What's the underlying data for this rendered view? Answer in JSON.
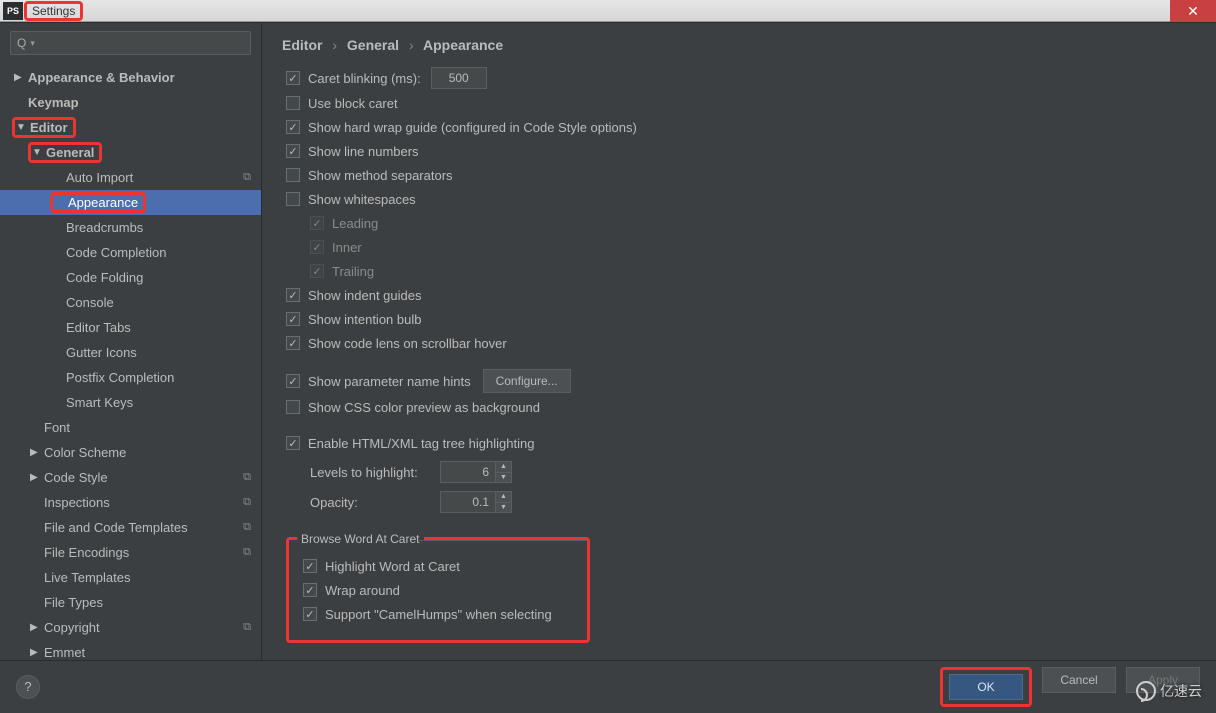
{
  "window": {
    "title": "Settings",
    "app_badge": "PS"
  },
  "search": {
    "placeholder": ""
  },
  "tree": {
    "items": [
      {
        "label": "Appearance & Behavior",
        "arrow": "▶",
        "bold": true,
        "indent": 0
      },
      {
        "label": "Keymap",
        "arrow": "",
        "bold": true,
        "indent": 0
      },
      {
        "label": "Editor",
        "arrow": "▼",
        "bold": true,
        "indent": 0,
        "hl": true
      },
      {
        "label": "General",
        "arrow": "▼",
        "bold": true,
        "indent": 1,
        "hl": true
      },
      {
        "label": "Auto Import",
        "arrow": "",
        "indent": 2,
        "copy": true
      },
      {
        "label": "Appearance",
        "arrow": "",
        "indent": 2,
        "selected": true,
        "hl": true
      },
      {
        "label": "Breadcrumbs",
        "arrow": "",
        "indent": 2
      },
      {
        "label": "Code Completion",
        "arrow": "",
        "indent": 2
      },
      {
        "label": "Code Folding",
        "arrow": "",
        "indent": 2
      },
      {
        "label": "Console",
        "arrow": "",
        "indent": 2
      },
      {
        "label": "Editor Tabs",
        "arrow": "",
        "indent": 2
      },
      {
        "label": "Gutter Icons",
        "arrow": "",
        "indent": 2
      },
      {
        "label": "Postfix Completion",
        "arrow": "",
        "indent": 2
      },
      {
        "label": "Smart Keys",
        "arrow": "",
        "indent": 2
      },
      {
        "label": "Font",
        "arrow": "",
        "indent": 1
      },
      {
        "label": "Color Scheme",
        "arrow": "▶",
        "indent": 1
      },
      {
        "label": "Code Style",
        "arrow": "▶",
        "indent": 1,
        "copy": true
      },
      {
        "label": "Inspections",
        "arrow": "",
        "indent": 1,
        "copy": true
      },
      {
        "label": "File and Code Templates",
        "arrow": "",
        "indent": 1,
        "copy": true
      },
      {
        "label": "File Encodings",
        "arrow": "",
        "indent": 1,
        "copy": true
      },
      {
        "label": "Live Templates",
        "arrow": "",
        "indent": 1
      },
      {
        "label": "File Types",
        "arrow": "",
        "indent": 1
      },
      {
        "label": "Copyright",
        "arrow": "▶",
        "indent": 1,
        "copy": true
      },
      {
        "label": "Emmet",
        "arrow": "▶",
        "indent": 1
      }
    ]
  },
  "breadcrumb": {
    "a": "Editor",
    "b": "General",
    "c": "Appearance"
  },
  "opts": {
    "caret_blinking": "Caret blinking (ms):",
    "caret_ms": "500",
    "use_block_caret": "Use block caret",
    "hard_wrap": "Show hard wrap guide (configured in Code Style options)",
    "line_numbers": "Show line numbers",
    "method_sep": "Show method separators",
    "whitespaces": "Show whitespaces",
    "leading": "Leading",
    "inner": "Inner",
    "trailing": "Trailing",
    "indent_guides": "Show indent guides",
    "intention_bulb": "Show intention bulb",
    "code_lens": "Show code lens on scrollbar hover",
    "param_hints": "Show parameter name hints",
    "configure": "Configure...",
    "css_preview": "Show CSS color preview as background",
    "tag_tree": "Enable HTML/XML tag tree highlighting",
    "levels_label": "Levels to highlight:",
    "levels_val": "6",
    "opacity_label": "Opacity:",
    "opacity_val": "0.1"
  },
  "browse_group": {
    "title": "Browse Word At Caret",
    "hl_word": "Highlight Word at Caret",
    "wrap": "Wrap around",
    "camel": "Support \"CamelHumps\" when selecting"
  },
  "buttons": {
    "ok": "OK",
    "cancel": "Cancel",
    "apply": "Apply",
    "help": "?"
  },
  "watermark": "亿速云"
}
